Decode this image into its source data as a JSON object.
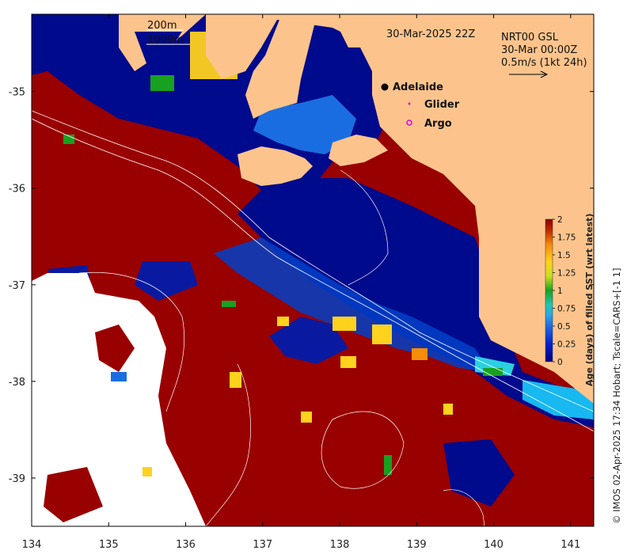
{
  "map": {
    "title_time": "30-Mar-2025 22Z",
    "contour_labels": {
      "c200": "200m",
      "c1000": "1000m"
    },
    "current": {
      "source": "NRT00 GSL",
      "time": "30-Mar 00:00Z",
      "scale": "0.5m/s (1kt 24h)"
    },
    "markers": [
      {
        "label": "Adelaide",
        "symbol": "filled-circle",
        "color": "#000000"
      },
      {
        "label": "Glider",
        "symbol": "dot",
        "color": "#e000e0"
      },
      {
        "label": "Argo",
        "symbol": "open-circle",
        "color": "#e000e0"
      }
    ],
    "x_ticks": [
      "134",
      "135",
      "136",
      "137",
      "138",
      "139",
      "140",
      "141"
    ],
    "y_ticks": [
      "-35",
      "-36",
      "-37",
      "-38",
      "-39"
    ],
    "colorbar": {
      "title": "Age (days) of filled SST (wrt latest)",
      "ticks": [
        "2",
        "1.75",
        "1.5",
        "1.25",
        "1",
        "0.75",
        "0.5",
        "0.25",
        "0"
      ]
    },
    "credit": "© IMOS 02-Apr-2025 17:34 Hobart; Tscale=CARS+[-1 1]",
    "colors": {
      "land": "#fcc48c",
      "age_0": "#000a8c",
      "age_2": "#990000",
      "no_data": "#ffffff"
    }
  },
  "chart_data": {
    "type": "heatmap",
    "title": "30-Mar-2025 22Z",
    "xlim": [
      134,
      141.3
    ],
    "ylim": [
      -39.5,
      -34.2
    ],
    "x_ticks": [
      134,
      135,
      136,
      137,
      138,
      139,
      140,
      141
    ],
    "y_ticks": [
      -35,
      -36,
      -37,
      -38,
      -39
    ],
    "colorbar_range": [
      0,
      2
    ],
    "colorbar_label": "Age (days) of filled SST (wrt latest)",
    "annotations": [
      "200m",
      "1000m",
      "NRT00 GSL",
      "30-Mar 00:00Z",
      "0.5m/s (1kt 24h)",
      "Adelaide",
      "Glider",
      "Argo"
    ]
  }
}
